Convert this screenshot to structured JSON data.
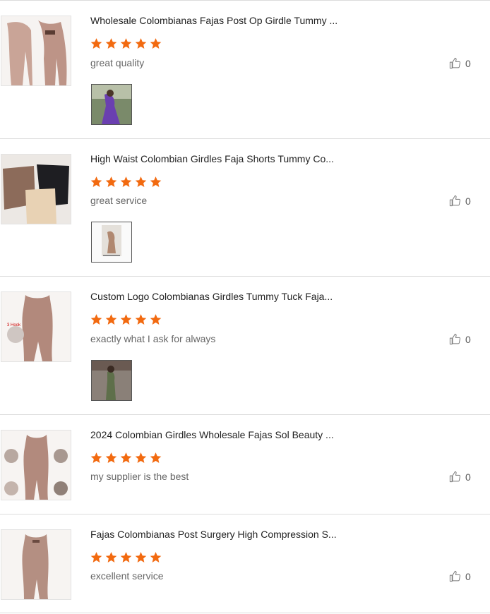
{
  "colors": {
    "star": "#f26a10",
    "border": "#dcdcdc"
  },
  "reviews": [
    {
      "title": "Wholesale Colombianas Fajas Post Op Girdle Tummy ...",
      "rating": 5,
      "comment": "great quality",
      "likes": "0",
      "has_photo": true
    },
    {
      "title": "High Waist Colombian Girdles Faja Shorts Tummy Co...",
      "rating": 5,
      "comment": "great service",
      "likes": "0",
      "has_photo": true
    },
    {
      "title": "Custom Logo Colombianas Girdles Tummy Tuck Faja...",
      "rating": 5,
      "comment": "exactly what I ask for always",
      "likes": "0",
      "has_photo": true
    },
    {
      "title": "2024 Colombian Girdles Wholesale Fajas Sol Beauty ...",
      "rating": 5,
      "comment": "my supplier is the best",
      "likes": "0",
      "has_photo": false
    },
    {
      "title": "Fajas Colombianas Post Surgery High Compression S...",
      "rating": 5,
      "comment": "excellent service",
      "likes": "0",
      "has_photo": false
    }
  ]
}
